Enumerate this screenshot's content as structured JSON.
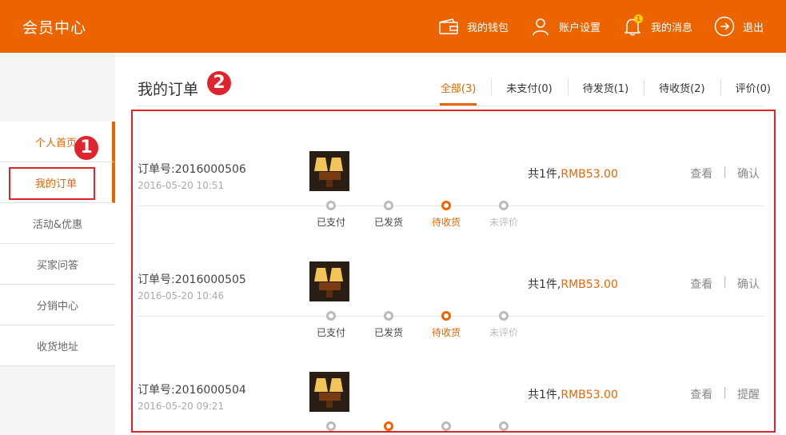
{
  "header": {
    "brand": "会员中心",
    "nav": [
      {
        "icon": "wallet-icon",
        "label": "我的钱包"
      },
      {
        "icon": "user-icon",
        "label": "账户设置"
      },
      {
        "icon": "bell-icon",
        "label": "我的消息",
        "badge": "1"
      },
      {
        "icon": "logout-icon",
        "label": "退出"
      }
    ]
  },
  "sidebar": {
    "items": [
      {
        "label": "个人首页"
      },
      {
        "label": "我的订单"
      },
      {
        "label": "活动&优惠"
      },
      {
        "label": "买家问答"
      },
      {
        "label": "分销中心"
      },
      {
        "label": "收货地址"
      }
    ]
  },
  "main": {
    "title": "我的订单",
    "tabs": [
      {
        "label": "全部(3)"
      },
      {
        "label": "未支付(0)"
      },
      {
        "label": "待发货(1)"
      },
      {
        "label": "待收货(2)"
      },
      {
        "label": "评价(0)"
      }
    ]
  },
  "callouts": [
    "1",
    "2"
  ],
  "orders": [
    {
      "order_no": "订单号:2016000506",
      "date": "2016-05-20 10:51",
      "total_prefix": "共1件,",
      "price": "RMB53.00",
      "view": "查看",
      "separator": "|",
      "action": "确认",
      "steps": [
        "已支付",
        "已发货",
        "待收货",
        "未评价"
      ]
    },
    {
      "order_no": "订单号:2016000505",
      "date": "2016-05-20 10:46",
      "total_prefix": "共1件,",
      "price": "RMB53.00",
      "view": "查看",
      "separator": "|",
      "action": "确认",
      "steps": [
        "已支付",
        "已发货",
        "待收货",
        "未评价"
      ]
    },
    {
      "order_no": "订单号:2016000504",
      "date": "2016-05-20 09:21",
      "total_prefix": "共1件,",
      "price": "RMB53.00",
      "view": "查看",
      "separator": "|",
      "action": "提醒"
    }
  ],
  "colors": {
    "brand": "#ec6400",
    "highlight": "#e0242d"
  }
}
